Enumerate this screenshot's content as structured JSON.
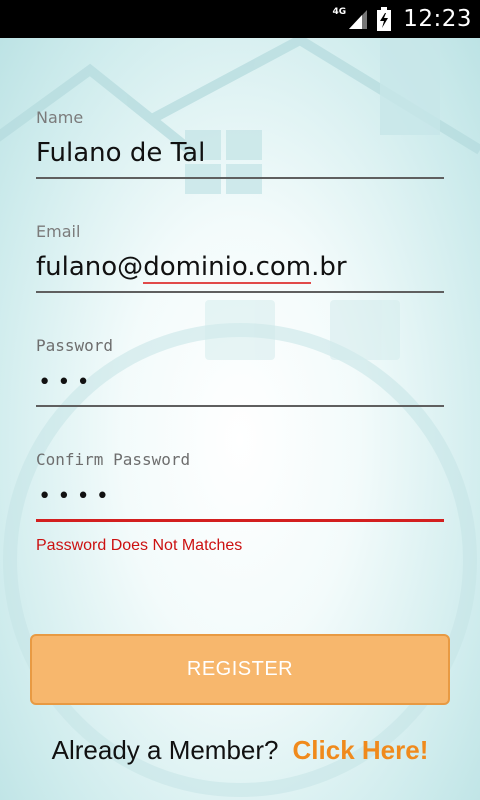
{
  "status_bar": {
    "network": "4G",
    "time": "12:23",
    "icons": [
      "signal-icon",
      "battery-charging-icon"
    ]
  },
  "form": {
    "name": {
      "label": "Name",
      "value": "Fulano de Tal"
    },
    "email": {
      "label": "Email",
      "value_prefix": "fulano@",
      "value_misspelled": "dominio.com",
      "value_suffix": ".br"
    },
    "password": {
      "label": "Password",
      "value_masked": "•••"
    },
    "confirm_password": {
      "label": "Confirm Password",
      "value_masked": "••••"
    },
    "error": "Password Does Not Matches",
    "register_label": "REGISTER",
    "member_prompt": "Already a Member?",
    "member_link": "Click Here!"
  },
  "colors": {
    "accent": "#f7b76d",
    "link": "#f08a1c",
    "error": "#cc1111",
    "background": "#dff2f2"
  }
}
